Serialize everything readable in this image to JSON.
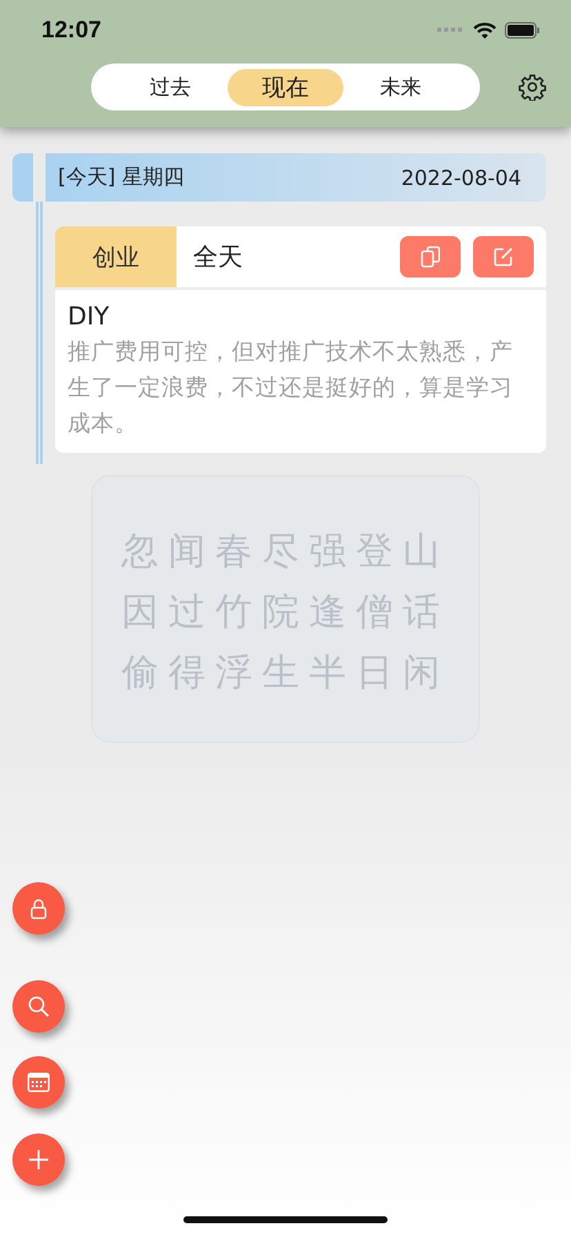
{
  "status_bar": {
    "time": "12:07"
  },
  "tabs": [
    {
      "label": "过去",
      "selected": false
    },
    {
      "label": "现在",
      "selected": true
    },
    {
      "label": "未来",
      "selected": false
    }
  ],
  "day": {
    "label": "[今天] 星期四",
    "date": "2022-08-04",
    "entries": [
      {
        "category": "创业",
        "time": "全天",
        "title": "DIY",
        "note": "推广费用可控，但对推广技术不太熟悉，产生了一定浪费，不过还是挺好的，算是学习成本。"
      }
    ]
  },
  "poem": {
    "lines": [
      "忽闻春尽强登山",
      "因过竹院逢僧话",
      "偷得浮生半日闲"
    ]
  }
}
